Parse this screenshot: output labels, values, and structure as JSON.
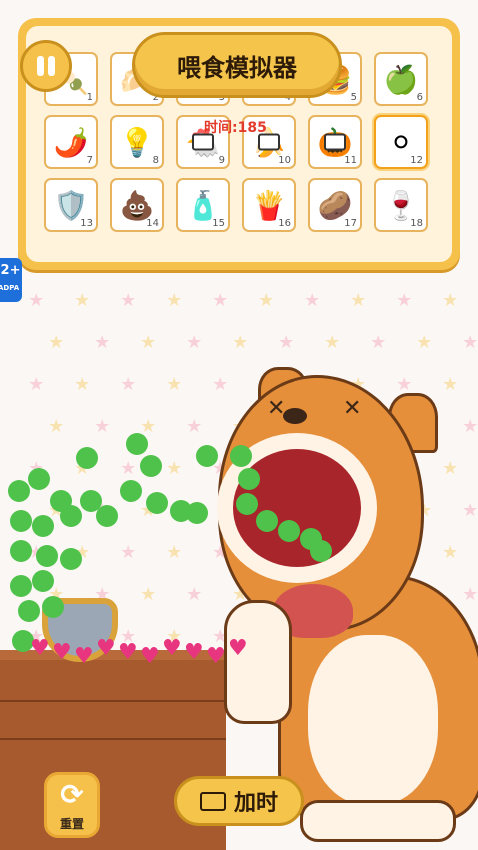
{
  "game": {
    "title": "喂食模拟器",
    "timer_text": "时间:185",
    "age_rating": "12+",
    "age_sub": "CADPA",
    "add_time_label": "加时",
    "reset_label": "重置"
  },
  "items": [
    {
      "num": "1",
      "icon": "🍡"
    },
    {
      "num": "2",
      "icon": "🥟"
    },
    {
      "num": "3",
      "icon": ""
    },
    {
      "num": "4",
      "icon": ""
    },
    {
      "num": "5",
      "icon": "🍔"
    },
    {
      "num": "6",
      "icon": "🍏"
    },
    {
      "num": "7",
      "icon": "🌶️"
    },
    {
      "num": "8",
      "icon": "💡"
    },
    {
      "num": "9",
      "icon": "🐔",
      "video": true
    },
    {
      "num": "10",
      "icon": "🍌",
      "video": true
    },
    {
      "num": "11",
      "icon": "🎃",
      "video": true
    },
    {
      "num": "12",
      "icon": "⚪",
      "selected": true
    },
    {
      "num": "13",
      "icon": "🛡️"
    },
    {
      "num": "14",
      "icon": "💩"
    },
    {
      "num": "15",
      "icon": "🧴"
    },
    {
      "num": "16",
      "icon": "🍟"
    },
    {
      "num": "17",
      "icon": "🥔"
    },
    {
      "num": "18",
      "icon": "🍷"
    }
  ]
}
